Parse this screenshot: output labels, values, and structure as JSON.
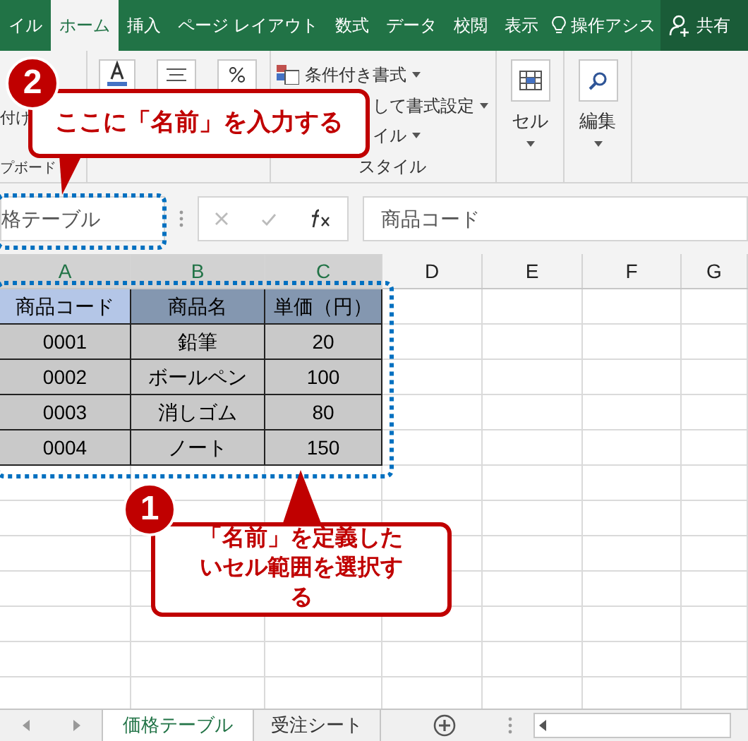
{
  "ribbon_tabs": [
    {
      "label": "イル",
      "selected": false
    },
    {
      "label": "ホーム",
      "selected": true
    },
    {
      "label": "挿入",
      "selected": false
    },
    {
      "label": "ページ レイアウト",
      "selected": false
    },
    {
      "label": "数式",
      "selected": false
    },
    {
      "label": "データ",
      "selected": false
    },
    {
      "label": "校閲",
      "selected": false
    },
    {
      "label": "表示",
      "selected": false
    }
  ],
  "tell_me": "操作アシス",
  "share": "共有",
  "ribbon": {
    "paste": "付け",
    "clipboard_label": "プボード",
    "conditional_formatting": "条件付き書式",
    "format_as_table": "して書式設定",
    "cell_styles": "イル",
    "styles_label": "スタイル",
    "cells_label": "セル",
    "editing_label": "編集"
  },
  "name_box": "格テーブル",
  "formula": "商品コード",
  "columns": [
    {
      "label": "A",
      "selected": true
    },
    {
      "label": "B",
      "selected": true
    },
    {
      "label": "C",
      "selected": true
    },
    {
      "label": "D",
      "selected": false
    },
    {
      "label": "E",
      "selected": false
    },
    {
      "label": "F",
      "selected": false
    },
    {
      "label": "G",
      "selected": false
    }
  ],
  "header_cells": [
    {
      "text": "商品コード",
      "active": true
    },
    {
      "text": "商品名",
      "active": false
    },
    {
      "text": "単価（円）",
      "active": false
    }
  ],
  "rows": [
    [
      "0001",
      "鉛筆",
      "20"
    ],
    [
      "0002",
      "ボールペン",
      "100"
    ],
    [
      "0003",
      "消しゴム",
      "80"
    ],
    [
      "0004",
      "ノート",
      "150"
    ]
  ],
  "sheet_tabs": [
    {
      "label": "価格テーブル",
      "selected": true
    },
    {
      "label": "受注シート",
      "selected": false
    }
  ],
  "callouts": [
    {
      "number": "2",
      "text": "ここに「名前」を入力する"
    },
    {
      "number": "1",
      "text": "「名前」を定義したいセル範囲を選択する"
    }
  ]
}
